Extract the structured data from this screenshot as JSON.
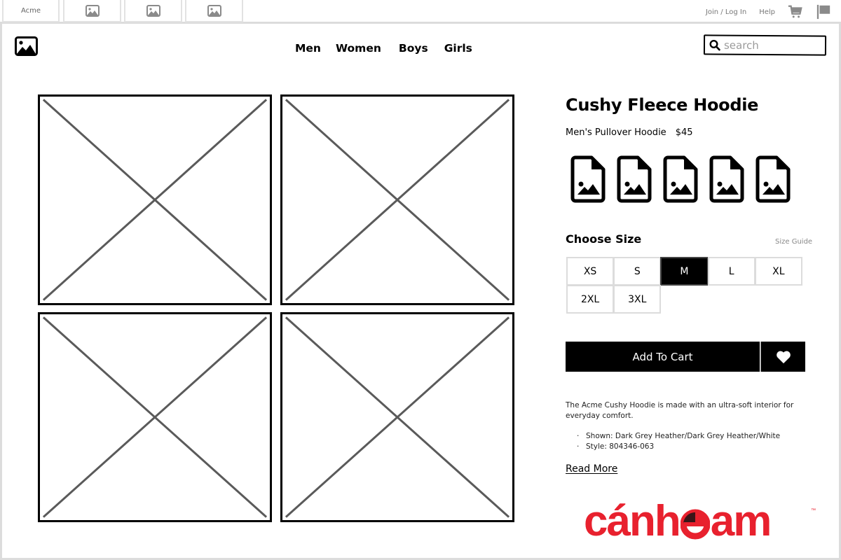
{
  "tabbar": {
    "site_tab": "Acme",
    "image_tabs": [
      "image-icon",
      "image-icon",
      "image-icon"
    ],
    "links": {
      "join": "Join / Log In",
      "help": "Help"
    },
    "icons": [
      "cart-icon",
      "flag-icon"
    ]
  },
  "header": {
    "logo_icon": "image-icon",
    "nav": [
      "Men",
      "Women",
      "Boys",
      "Girls"
    ],
    "search": {
      "placeholder": "search",
      "value": ""
    }
  },
  "gallery": {
    "placeholders": 4
  },
  "product": {
    "title": "Cushy Fleece Hoodie",
    "category": "Men's Pullover Hoodie",
    "price": "$45",
    "thumbnails": 5,
    "choose_size_label": "Choose Size",
    "size_guide_label": "Size Guide",
    "sizes": [
      "XS",
      "S",
      "M",
      "L",
      "XL",
      "2XL",
      "3XL"
    ],
    "selected_size": "M",
    "add_to_cart_label": "Add To Cart",
    "favorite_icon": "heart-icon",
    "description": "The Acme Cushy Hoodie is made with an ultra-soft interior for everyday comfort.",
    "details": [
      "Shown: Dark Grey Heather/Dark Grey Heather/White",
      "Style: 804346-063"
    ],
    "read_more_label": "Read More"
  },
  "brand": {
    "text_before": "cánh",
    "text_after": "am",
    "trademark": "™",
    "color": "#e8212e",
    "accent_color": "#3a1518"
  },
  "colors": {
    "border_light": "#dcdcdc",
    "placeholder_line": "#5a5a5a",
    "muted_text": "#777777"
  }
}
